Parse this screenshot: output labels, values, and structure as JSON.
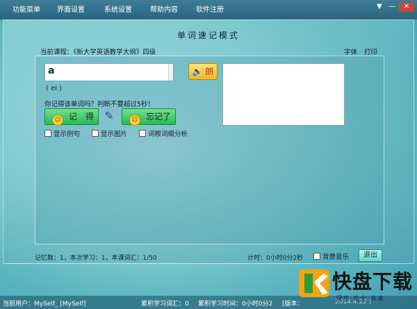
{
  "menubar": {
    "items": [
      "功能菜单",
      "界面设置",
      "系统设置",
      "帮助内容",
      "软件注册"
    ],
    "controls": [
      "▼",
      "—",
      "✕"
    ]
  },
  "title": "单词速记模式",
  "course": "当前课程：《新大学英语教学大纲》四级",
  "topright": {
    "font": "字体",
    "print": "打印"
  },
  "word": "a",
  "speak_label": "朗",
  "phonetic": "( ei )",
  "prompt": "你记得该单词吗？判断不要超过5秒！",
  "buttons": {
    "remember": "记　得",
    "forgot": "忘记了"
  },
  "checkboxes": {
    "example": "显示例句",
    "image": "显示图片",
    "root": "词根词缀分析"
  },
  "status": {
    "memo": "记忆数：1，本次学习：1，本课词汇：1/50",
    "timer": "计时：0小时0分2秒",
    "music": "背景音乐",
    "exit": "退出"
  },
  "bottom": {
    "user": "当前用户：MySelf_ [MySelf]",
    "learned": "累积学习词汇：0",
    "time": "累积学习时间：0小时0分2",
    "version": "[版本：",
    "version_tail": "2014.4.22 ]"
  },
  "watermark": {
    "main": "快盘下载",
    "sub": "绿色·安全·高速",
    "logo_letter": "K"
  }
}
